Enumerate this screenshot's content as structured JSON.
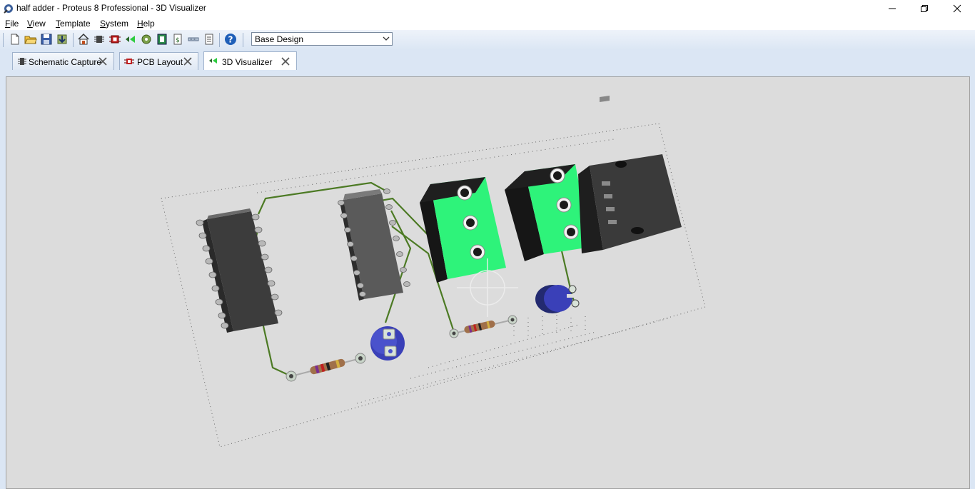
{
  "window": {
    "title": "half adder - Proteus 8 Professional - 3D Visualizer"
  },
  "menu": {
    "items": [
      "File",
      "View",
      "Template",
      "System",
      "Help"
    ],
    "underline": [
      "F",
      "V",
      "T",
      "S",
      "H"
    ]
  },
  "toolbar": {
    "variant_value": "Base Design",
    "buttons": [
      "new-file",
      "open-folder",
      "save",
      "import",
      "home",
      "schematic",
      "pcb",
      "gerber",
      "3d-visualizer",
      "bom",
      "design-explorer",
      "netlist",
      "report",
      "help"
    ]
  },
  "tabs": [
    {
      "label": "Schematic Capture",
      "icon": "schematic-icon",
      "active": false
    },
    {
      "label": "PCB Layout",
      "icon": "pcb-icon",
      "active": false
    },
    {
      "label": "3D Visualizer",
      "icon": "3d-icon",
      "active": true
    }
  ],
  "colors": {
    "viewport_bg": "#dcdcdc",
    "terminal_green": "#2ef37a",
    "trace_green": "#4c7a24",
    "ic_body": "#555555",
    "capacitor_blue": "#3a40b8"
  }
}
